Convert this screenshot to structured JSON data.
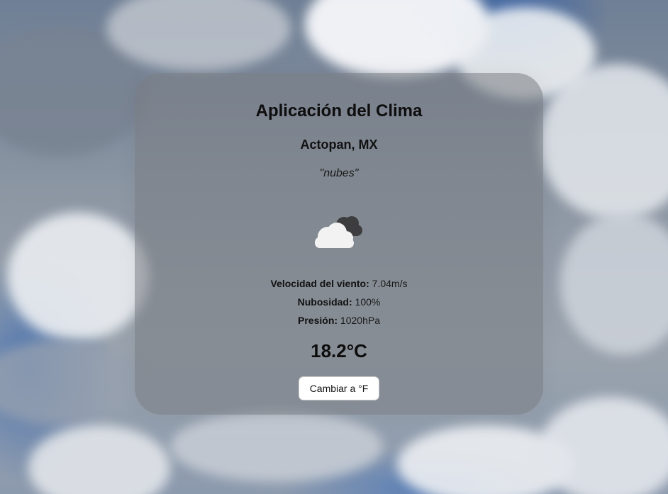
{
  "app": {
    "title": "Aplicación del Clima"
  },
  "weather": {
    "location": "Actopan, MX",
    "description": "\"nubes\"",
    "icon": "broken-clouds-icon",
    "wind_label": "Velocidad del viento:",
    "wind_value": " 7.04m/s",
    "cloudiness_label": "Nubosidad:",
    "cloudiness_value": " 100%",
    "pressure_label": "Presión:",
    "pressure_value": " 1020hPa",
    "temperature": "18.2°C"
  },
  "controls": {
    "toggle_unit_label": "Cambiar a °F"
  },
  "colors": {
    "card_background": "#7c8086",
    "button_background": "#ffffff",
    "text": "#111111"
  }
}
